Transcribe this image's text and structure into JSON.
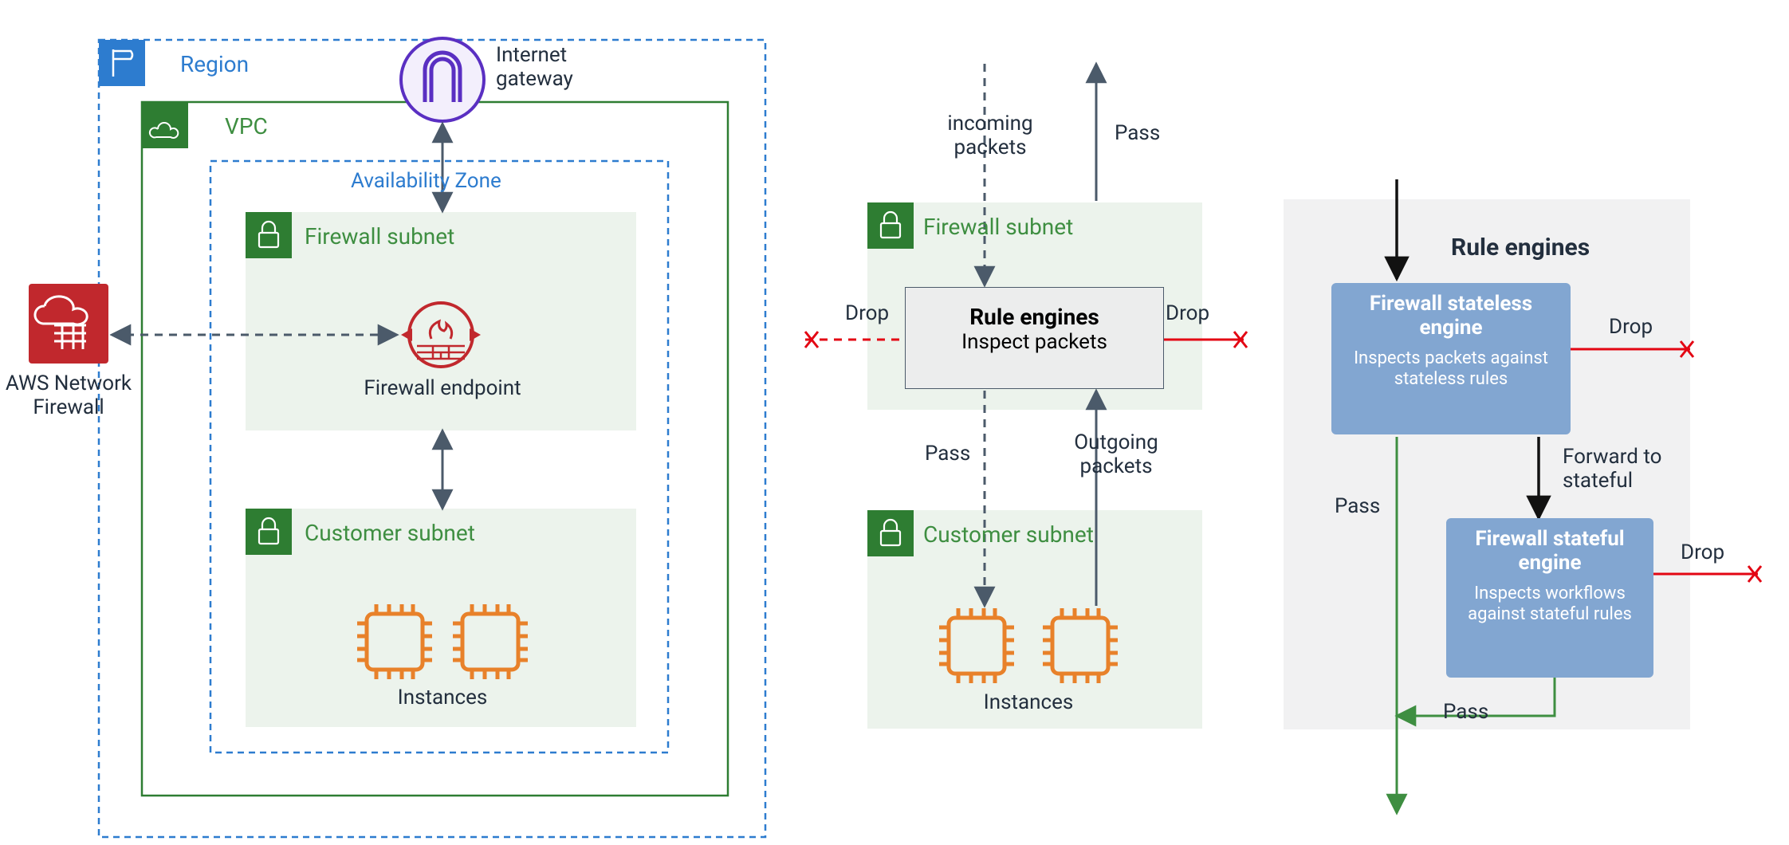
{
  "left": {
    "region": "Region",
    "vpc": "VPC",
    "az": "Availability Zone",
    "internet_gateway": "Internet\ngateway",
    "firewall_subnet": "Firewall subnet",
    "firewall_endpoint": "Firewall endpoint",
    "customer_subnet": "Customer subnet",
    "instances": "Instances",
    "aws_nf": "AWS Network\nFirewall"
  },
  "middle": {
    "incoming": "incoming\npackets",
    "outgoing": "Outgoing\npackets",
    "pass": "Pass",
    "drop": "Drop",
    "firewall_subnet": "Firewall subnet",
    "rule_engines": "Rule engines",
    "inspect": "Inspect packets",
    "customer_subnet": "Customer subnet",
    "instances": "Instances"
  },
  "right": {
    "title": "Rule engines",
    "stateless_title": "Firewall stateless engine",
    "stateless_sub": "Inspects packets against stateless rules",
    "stateful_title": "Firewall stateful engine",
    "stateful_sub": "Inspects workflows against stateful rules",
    "drop": "Drop",
    "forward": "Forward to\nstateful",
    "pass": "Pass"
  }
}
